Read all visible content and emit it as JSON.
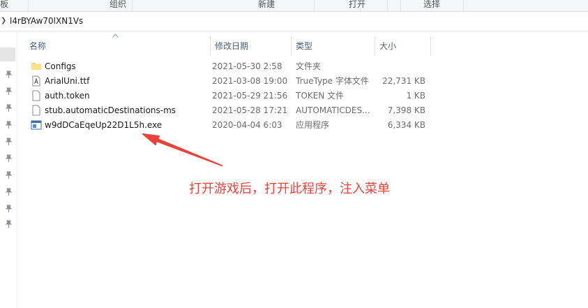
{
  "ribbon": {
    "groups": [
      "板",
      "组织",
      "新建",
      "打开",
      "选择"
    ]
  },
  "address": {
    "path": "l4rBYAw70lXN1Vs"
  },
  "columns": {
    "name": "名称",
    "date": "修改日期",
    "type": "类型",
    "size": "大小"
  },
  "files": [
    {
      "name": "Configs",
      "date": "2021-05-30 2:58",
      "type": "文件夹",
      "size": "",
      "icon": "folder-icon"
    },
    {
      "name": "ArialUni.ttf",
      "date": "2021-03-08 19:00",
      "type": "TrueType 字体文件",
      "size": "22,731 KB",
      "icon": "font-file-icon"
    },
    {
      "name": "auth.token",
      "date": "2021-05-29 21:56",
      "type": "TOKEN 文件",
      "size": "1 KB",
      "icon": "file-icon"
    },
    {
      "name": "stub.automaticDestinations-ms",
      "date": "2021-05-28 17:21",
      "type": "AUTOMATICDES...",
      "size": "7,398 KB",
      "icon": "file-icon"
    },
    {
      "name": "w9dDCaEqeUp22D1L5h.exe",
      "date": "2020-04-04 6:03",
      "type": "应用程序",
      "size": "6,334 KB",
      "icon": "exe-icon"
    }
  ],
  "annotation": {
    "text": "打开游戏后，打开此程序，注入菜单",
    "color": "#e8423a"
  }
}
